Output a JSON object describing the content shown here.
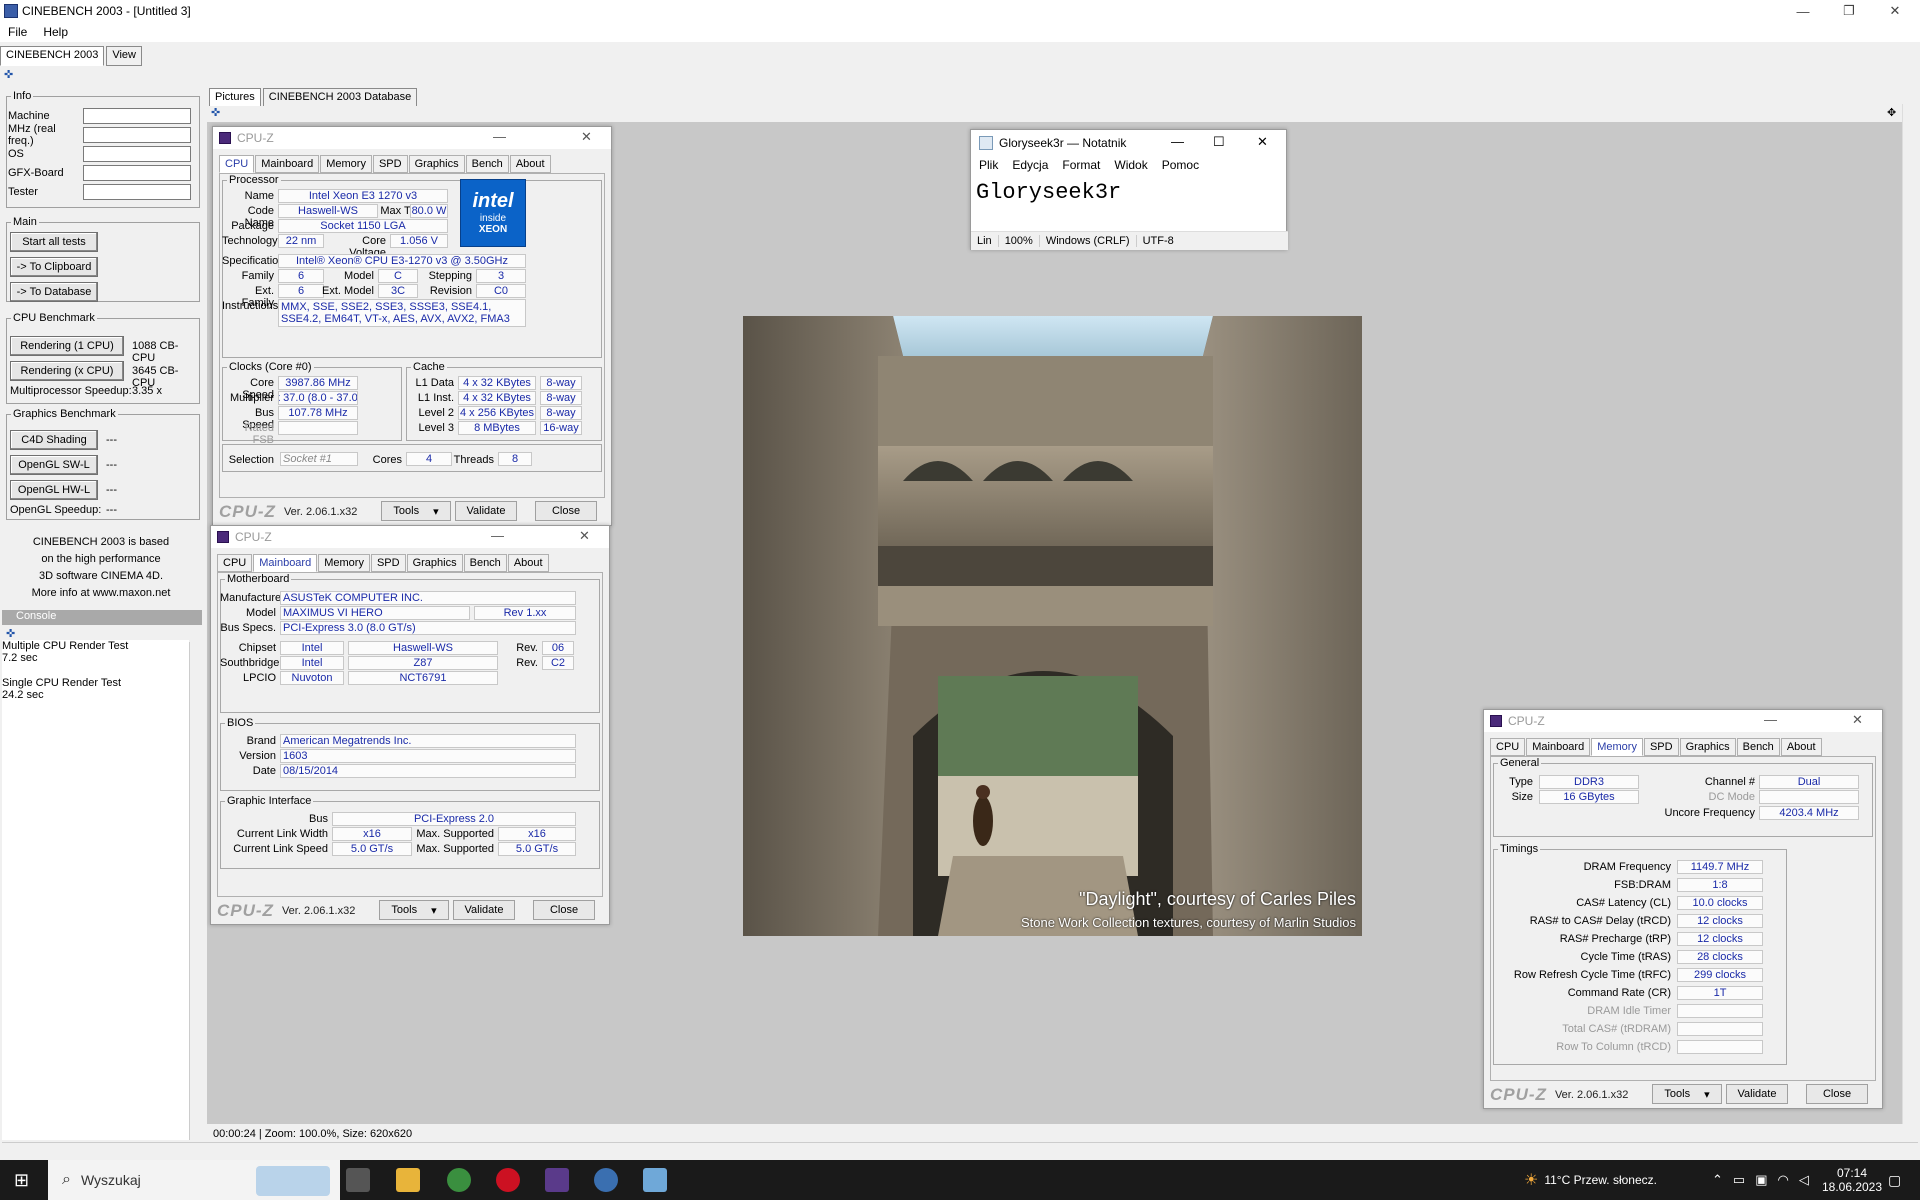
{
  "window": {
    "title": "CINEBENCH 2003 - [Untitled 3]",
    "menu": [
      "File",
      "Help"
    ],
    "main_tabs": [
      "CINEBENCH 2003",
      "View"
    ]
  },
  "left": {
    "info_title": "Info",
    "info_fields": [
      "Machine",
      "MHz (real freq.)",
      "OS",
      "GFX-Board",
      "Tester"
    ],
    "main_title": "Main",
    "main_buttons": [
      "Start all tests",
      "-> To Clipboard",
      "-> To Database"
    ],
    "cpu_title": "CPU Benchmark",
    "cpu_buttons": [
      "Rendering (1 CPU)",
      "Rendering (x CPU)"
    ],
    "cpu_results": [
      "1088 CB-CPU",
      "3645 CB-CPU"
    ],
    "mp_label": "Multiprocessor Speedup:",
    "mp_value": "3.35 x",
    "gfx_title": "Graphics Benchmark",
    "gfx_buttons": [
      "C4D Shading",
      "OpenGL SW-L",
      "OpenGL HW-L"
    ],
    "gfx_results": [
      "---",
      "---",
      "---"
    ],
    "ogl_label": "OpenGL Speedup:",
    "ogl_value": "---",
    "about_lines": [
      "CINEBENCH 2003 is based",
      "on the high performance",
      "3D software CINEMA 4D.",
      "More info at www.maxon.net"
    ],
    "console_title": "Console",
    "console_lines": [
      "Multiple CPU Render Test",
      "7.2 sec",
      "",
      "Single CPU Render Test",
      "24.2 sec"
    ]
  },
  "work": {
    "tabs": [
      "Pictures",
      "CINEBENCH 2003 Database"
    ],
    "status": "00:00:24  |  Zoom: 100.0%, Size: 620x620"
  },
  "cpuz_common": {
    "title": "CPU-Z",
    "tabs": [
      "CPU",
      "Mainboard",
      "Memory",
      "SPD",
      "Graphics",
      "Bench",
      "About"
    ],
    "brand": "CPU-Z",
    "version": "Ver. 2.06.1.x32",
    "tools": "Tools",
    "validate": "Validate",
    "close": "Close"
  },
  "cpu": {
    "processor_title": "Processor",
    "name_lbl": "Name",
    "name": "Intel Xeon E3 1270 v3",
    "code_lbl": "Code Name",
    "code": "Haswell-WS",
    "tdp_lbl": "Max TDP",
    "tdp": "80.0 W",
    "pkg_lbl": "Package",
    "pkg": "Socket 1150 LGA",
    "tech_lbl": "Technology",
    "tech": "22 nm",
    "volt_lbl": "Core Voltage",
    "volt": "1.056 V",
    "spec_lbl": "Specification",
    "spec": "Intel® Xeon® CPU E3-1270 v3 @ 3.50GHz",
    "family_lbl": "Family",
    "family": "6",
    "model_lbl": "Model",
    "model": "C",
    "stepping_lbl": "Stepping",
    "stepping": "3",
    "extfam_lbl": "Ext. Family",
    "extfam": "6",
    "extmodel_lbl": "Ext. Model",
    "extmodel": "3C",
    "rev_lbl": "Revision",
    "rev": "C0",
    "instr_lbl": "Instructions",
    "instr": "MMX, SSE, SSE2, SSE3, SSSE3, SSE4.1, SSE4.2, EM64T, VT-x, AES, AVX, AVX2, FMA3",
    "clocks_title": "Clocks (Core #0)",
    "corespeed_lbl": "Core Speed",
    "corespeed": "3987.86 MHz",
    "mult_lbl": "Multiplier",
    "mult": "x 37.0 (8.0 - 37.0)",
    "bus_lbl": "Bus Speed",
    "bus": "107.78 MHz",
    "fsb_lbl": "Rated FSB",
    "cache_title": "Cache",
    "l1d_lbl": "L1 Data",
    "l1d": "4 x 32 KBytes",
    "l1d_w": "8-way",
    "l1i_lbl": "L1 Inst.",
    "l1i": "4 x 32 KBytes",
    "l1i_w": "8-way",
    "l2_lbl": "Level 2",
    "l2": "4 x 256 KBytes",
    "l2_w": "8-way",
    "l3_lbl": "Level 3",
    "l3": "8 MBytes",
    "l3_w": "16-way",
    "sel_lbl": "Selection",
    "sel": "Socket #1",
    "cores_lbl": "Cores",
    "cores": "4",
    "threads_lbl": "Threads",
    "threads": "8",
    "logo_brand": "intel",
    "logo_inside": "inside",
    "logo_product": "XEON"
  },
  "mb": {
    "mb_title": "Motherboard",
    "manu_lbl": "Manufacturer",
    "manu": "ASUSTeK COMPUTER INC.",
    "model_lbl": "Model",
    "model": "MAXIMUS VI HERO",
    "model_rev": "Rev 1.xx",
    "busspec_lbl": "Bus Specs.",
    "busspec": "PCI-Express 3.0 (8.0 GT/s)",
    "chipset_lbl": "Chipset",
    "chipset": "Intel",
    "chipset2": "Haswell-WS",
    "chipset_rev_lbl": "Rev.",
    "chipset_rev": "06",
    "south_lbl": "Southbridge",
    "south": "Intel",
    "south2": "Z87",
    "south_rev_lbl": "Rev.",
    "south_rev": "C2",
    "lpcio_lbl": "LPCIO",
    "lpcio": "Nuvoton",
    "lpcio2": "NCT6791",
    "bios_title": "BIOS",
    "brand_lbl": "Brand",
    "brand": "American Megatrends Inc.",
    "ver_lbl": "Version",
    "ver": "1603",
    "date_lbl": "Date",
    "date": "08/15/2014",
    "gi_title": "Graphic Interface",
    "gibus_lbl": "Bus",
    "gibus": "PCI-Express 2.0",
    "clw_lbl": "Current Link Width",
    "clw": "x16",
    "msw_lbl": "Max. Supported",
    "msw": "x16",
    "cls_lbl": "Current Link Speed",
    "cls": "5.0 GT/s",
    "mss_lbl": "Max. Supported",
    "mss": "5.0 GT/s"
  },
  "mem": {
    "gen_title": "General",
    "type_lbl": "Type",
    "type": "DDR3",
    "size_lbl": "Size",
    "size": "16 GBytes",
    "chan_lbl": "Channel #",
    "chan": "Dual",
    "dc_lbl": "DC Mode",
    "unc_lbl": "Uncore Frequency",
    "unc": "4203.4 MHz",
    "tim_title": "Timings",
    "timings": [
      {
        "label": "DRAM Frequency",
        "value": "1149.7 MHz"
      },
      {
        "label": "FSB:DRAM",
        "value": "1:8"
      },
      {
        "label": "CAS# Latency (CL)",
        "value": "10.0 clocks"
      },
      {
        "label": "RAS# to CAS# Delay (tRCD)",
        "value": "12 clocks"
      },
      {
        "label": "RAS# Precharge (tRP)",
        "value": "12 clocks"
      },
      {
        "label": "Cycle Time (tRAS)",
        "value": "28 clocks"
      },
      {
        "label": "Row Refresh Cycle Time (tRFC)",
        "value": "299 clocks"
      },
      {
        "label": "Command Rate (CR)",
        "value": "1T"
      },
      {
        "label": "DRAM Idle Timer",
        "value": ""
      },
      {
        "label": "Total CAS# (tRDRAM)",
        "value": ""
      },
      {
        "label": "Row To Column (tRCD)",
        "value": ""
      }
    ]
  },
  "notepad": {
    "title": "Gloryseek3r — Notatnik",
    "menu": [
      "Plik",
      "Edycja",
      "Format",
      "Widok",
      "Pomoc"
    ],
    "text": "Gloryseek3r",
    "status": [
      "Lin",
      "100%",
      "Windows (CRLF)",
      "UTF-8"
    ]
  },
  "render": {
    "caption1": "\"Daylight\", courtesy of Carles Piles",
    "caption2": "Stone Work Collection textures, courtesy of Marlin Studios"
  },
  "taskbar": {
    "search_placeholder": "Wyszukaj",
    "weather": "11°C  Przew. słonecz.",
    "time": "07:14",
    "date": "18.06.2023"
  }
}
